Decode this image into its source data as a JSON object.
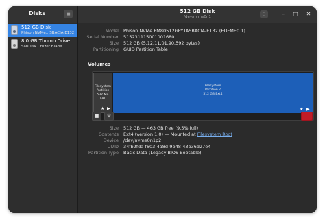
{
  "sidebar": {
    "title": "Disks",
    "menu_icon": "hamburger-menu-icon",
    "disks": [
      {
        "name": "512 GB Disk",
        "model": "Phison NVMe…SBACIA-E132",
        "icon": "ssd-drive-icon",
        "selected": true
      },
      {
        "name": "8.0 GB Thumb Drive",
        "model": "SanDisk Cruzer Blade",
        "icon": "usb-drive-icon",
        "selected": false
      }
    ]
  },
  "header": {
    "title": "512 GB Disk",
    "subtitle": "/dev/nvme0n1",
    "kebab_icon": "kebab-menu-icon",
    "minimize_glyph": "–",
    "maximize_glyph": "□",
    "close_glyph": "✕"
  },
  "disk_info": {
    "model_label": "Model",
    "model": "Phison NVMe PM80512GPYTASBACIA-E132 (EDFME0.1)",
    "serial_label": "Serial Number",
    "serial": "515231115001001680",
    "size_label": "Size",
    "size": "512 GB (5,12,11,01,90,592 bytes)",
    "partitioning_label": "Partitioning",
    "partitioning": "GUID Partition Table"
  },
  "volumes": {
    "title": "Volumes",
    "partitions": [
      {
        "line1": "Filesystem",
        "line2": "Partition 1...",
        "line3": "537 MB FAT"
      },
      {
        "line1": "Filesystem",
        "line2": "Partition 2",
        "line3": "512 GB Ext4"
      }
    ],
    "toolbar": {
      "stop_glyph": "■",
      "gear_glyph": "⚙",
      "delete_glyph": "—",
      "star_glyph": "★",
      "play_glyph": "▶"
    }
  },
  "volume_details": {
    "size_label": "Size",
    "size": "512 GB — 463 GB free (9.5% full)",
    "contents_label": "Contents",
    "contents_prefix": "Ext4 (version 1.0) — Mounted at ",
    "contents_link": "Filesystem Root",
    "device_label": "Device",
    "device": "/dev/nvme0n1p2",
    "uuid_label": "UUID",
    "uuid": "34fb2fda-f603-4a8d-9b48-43b36d27e4",
    "partition_type_label": "Partition Type",
    "partition_type": "Basic Data (Legacy BIOS Bootable)"
  },
  "colors": {
    "accent": "#3584e4",
    "partition_selected": "#1d5fb8",
    "delete": "#c01c28",
    "link": "#78aeed"
  }
}
